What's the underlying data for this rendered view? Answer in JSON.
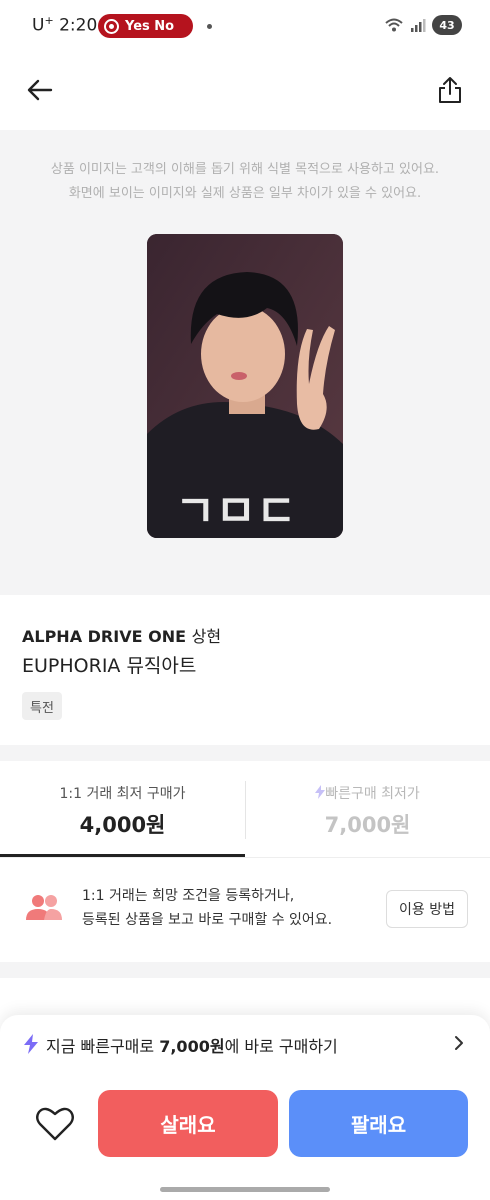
{
  "status_bar": {
    "carrier": "U",
    "carrier_sup": "+",
    "time": "2:20",
    "recording_label": "Yes No",
    "battery": "43"
  },
  "notice": {
    "line1": "상품 이미지는 고객의 이해를 돕기 위해 식별 목적으로 사용하고 있어요.",
    "line2": "화면에 보이는 이미지와 실제 상품은 일부 차이가 있을 수 있어요."
  },
  "product": {
    "brand": "ALPHA DRIVE ONE",
    "member": "상현",
    "name": "EUPHORIA 뮤직아트",
    "tag": "특전"
  },
  "tabs": [
    {
      "label": "1:1 거래 최저 구매가",
      "price": "4,000원"
    },
    {
      "label": "빠른구매 최저가",
      "price": "7,000원"
    }
  ],
  "info": {
    "line1": "1:1 거래는 희망 조건을 등록하거나,",
    "line2": "등록된 상품을 보고 바로 구매할 수 있어요.",
    "howto_label": "이용 방법"
  },
  "bottom": {
    "quick_prefix": "지금 빠른구매로 ",
    "quick_price": "7,000원",
    "quick_suffix": "에 바로 구매하기",
    "buy_label": "살래요",
    "sell_label": "팔래요"
  },
  "colors": {
    "buy": "#f25e5e",
    "sell": "#5b8ff9",
    "quick_bolt": "#7b6cf6",
    "info_icon": "#f07a7a"
  },
  "icons": [
    "back-arrow-icon",
    "share-icon",
    "people-icon",
    "bolt-icon",
    "chevron-right-icon",
    "heart-icon"
  ]
}
